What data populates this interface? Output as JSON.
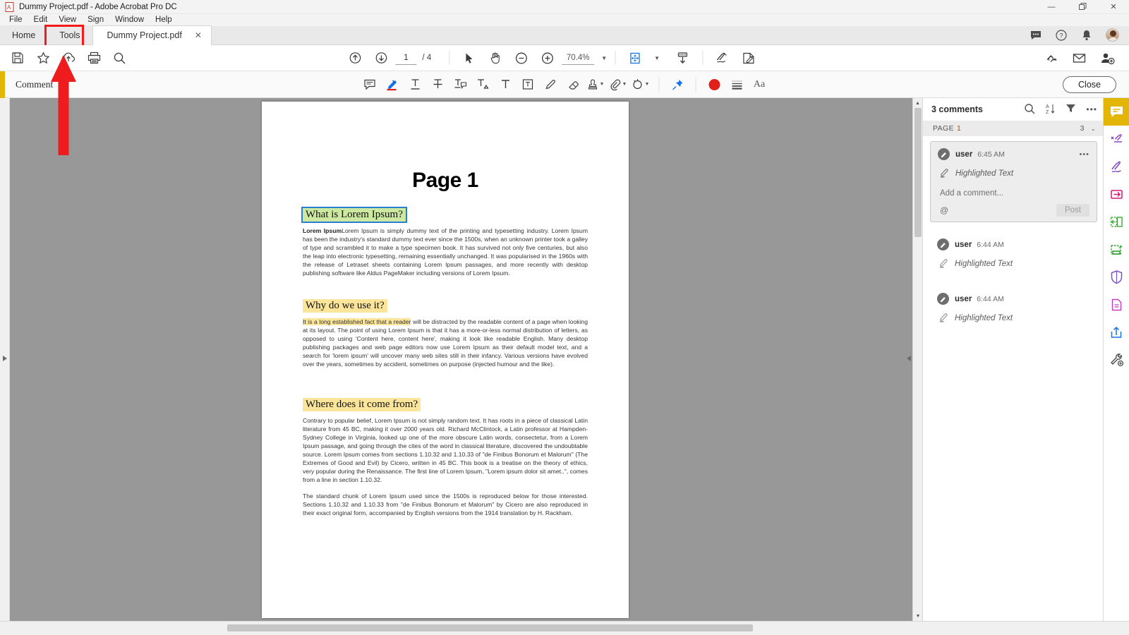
{
  "window": {
    "title": "Dummy Project.pdf - Adobe Acrobat Pro DC",
    "app_icon": "pdf-icon",
    "controls": {
      "minimize": "—",
      "restore": "❐",
      "close": "✕"
    }
  },
  "menubar": {
    "items": [
      "File",
      "Edit",
      "View",
      "Sign",
      "Window",
      "Help"
    ]
  },
  "tabs": {
    "home": "Home",
    "tools": "Tools",
    "document": "Dummy Project.pdf",
    "close_tab": "✕",
    "right_icons": [
      "chat-icon",
      "help-icon",
      "bell-icon",
      "avatar"
    ]
  },
  "toolbar": {
    "left_icons": [
      "save-icon",
      "star-icon",
      "cloud-upload-icon",
      "print-icon",
      "search-icon"
    ],
    "page_current": "1",
    "page_total": "/ 4",
    "zoom_value": "70.4%",
    "zoom_caret": "▼",
    "center_icons": [
      "select-tool-icon",
      "hand-tool-icon",
      "zoom-out-icon",
      "zoom-in-icon",
      "fit-page-icon",
      "scroll-mode-icon"
    ],
    "right_icons": [
      "sign-icon",
      "edit-pdf-icon"
    ],
    "share_icons": [
      "share-link-icon",
      "email-icon",
      "add-person-icon"
    ]
  },
  "comment_bar": {
    "title": "Comment",
    "accent_color": "#e3b505",
    "close_label": "Close",
    "tools": [
      "sticky-note-icon",
      "highlighter-icon",
      "underline-text-icon",
      "strikethrough-text-icon",
      "replace-text-icon",
      "insert-text-icon",
      "add-text-comment-icon",
      "text-box-icon",
      "draw-freehand-icon",
      "eraser-icon",
      "stamp-icon",
      "attach-file-icon",
      "add-audio-icon",
      "pin-icon",
      "color-swatch-icon",
      "line-thickness-icon",
      "font-size-icon"
    ],
    "color_swatch": "#e0201b",
    "font_size_label": "Aa"
  },
  "document": {
    "page_title": "Page 1",
    "sections": [
      {
        "heading": "What is Lorem Ipsum?",
        "heading_style": "green-highlight-selected",
        "paragraphs": [
          "Lorem Ipsum is simply dummy text of the printing and typesetting industry. Lorem Ipsum has been the industry's standard dummy text ever since the 1500s, when an unknown printer took a galley of type and scrambled it to make a type specimen book. It has survived not only five centuries, but also the leap into electronic typesetting, remaining essentially unchanged. It was popularised in the 1960s with the release of Letraset sheets containing Lorem Ipsum passages, and more recently with desktop publishing software like Aldus PageMaker including versions of Lorem Ipsum."
        ],
        "paragraph_bold_lead": "Lorem Ipsum"
      },
      {
        "heading": "Why do we use it?",
        "heading_style": "yellow-highlight",
        "highlighted_lead": "It is a long established fact that a reader",
        "paragraphs": [
          " will be distracted by the readable content of a page when looking at its layout. The point of using Lorem Ipsum is that it has a more-or-less normal distribution of letters, as opposed to using 'Content here, content here', making it look like readable English. Many desktop publishing packages and web page editors now use Lorem Ipsum as their default model text, and a search for 'lorem ipsum' will uncover many web sites still in their infancy. Various versions have evolved over the years, sometimes by accident, sometimes on purpose (injected humour and the like)."
        ]
      },
      {
        "heading": "Where does it come from?",
        "heading_style": "yellow-highlight",
        "paragraphs": [
          "Contrary to popular belief, Lorem Ipsum is not simply random text. It has roots in a piece of classical Latin literature from 45 BC, making it over 2000 years old. Richard McClintock, a Latin professor at Hampden-Sydney College in Virginia, looked up one of the more obscure Latin words, consectetur, from a Lorem Ipsum passage, and going through the cites of the word in classical literature, discovered the undoubtable source. Lorem Ipsum comes from sections 1.10.32 and 1.10.33 of \"de Finibus Bonorum et Malorum\" (The Extremes of Good and Evil) by Cicero, written in 45 BC. This book is a treatise on the theory of ethics, very popular during the Renaissance. The first line of Lorem Ipsum, \"Lorem ipsum dolor sit amet..\", comes from a line in section 1.10.32.",
          "The standard chunk of Lorem Ipsum used since the 1500s is reproduced below for those interested. Sections 1.10.32 and 1.10.33 from \"de Finibus Bonorum et Malorum\" by Cicero are also reproduced in their exact original form, accompanied by English versions from the 1914 translation by H. Rackham."
        ]
      }
    ]
  },
  "comments_panel": {
    "header": "3 comments",
    "header_icons": [
      "search-icon",
      "sort-az-icon",
      "filter-icon",
      "more-options-icon"
    ],
    "page_group": {
      "label": "PAGE",
      "page": "1",
      "count": "3",
      "chevron": "⌄"
    },
    "items": [
      {
        "author": "user",
        "time": "6:45 AM",
        "type": "Highlighted Text",
        "active": true,
        "reply_placeholder": "Add a comment...",
        "mention_icon": "@",
        "post_label": "Post",
        "more_icon": "•••"
      },
      {
        "author": "user",
        "time": "6:44 AM",
        "type": "Highlighted Text",
        "active": false
      },
      {
        "author": "user",
        "time": "6:44 AM",
        "type": "Highlighted Text",
        "active": false
      }
    ]
  },
  "right_rail": {
    "items": [
      {
        "name": "comment-tool",
        "active": true
      },
      {
        "name": "edit-pdf-tool",
        "active": false
      },
      {
        "name": "fill-and-sign-tool",
        "active": false
      },
      {
        "name": "export-pdf-tool",
        "active": false
      },
      {
        "name": "organize-pages-tool",
        "active": false
      },
      {
        "name": "create-pdf-tool",
        "active": false
      },
      {
        "name": "protect-tool",
        "active": false
      },
      {
        "name": "compress-pdf-tool",
        "active": false
      },
      {
        "name": "share-file-tool",
        "active": false
      },
      {
        "name": "more-tools",
        "active": false
      }
    ]
  },
  "annotation": {
    "arrow_color": "#ee1c1c",
    "highlight_box_color": "#f51a1a",
    "highlight_target": "Tools"
  }
}
